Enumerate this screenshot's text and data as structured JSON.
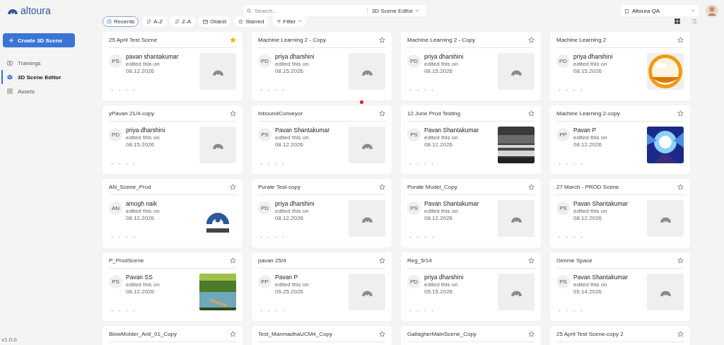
{
  "brand": "altoura",
  "sidebar": {
    "create_button": "Create 3D Scene",
    "items": [
      {
        "label": "Trainings",
        "selected": false
      },
      {
        "label": "3D Scene Editor",
        "selected": true
      },
      {
        "label": "Assets",
        "selected": false
      }
    ],
    "version": "v1.0.0"
  },
  "search": {
    "placeholder": "Search...",
    "scope": "3D Scene Editor"
  },
  "workspace": "Altoura QA",
  "sort_chips": [
    {
      "label": "Recents",
      "selected": true
    },
    {
      "label": "A-Z",
      "selected": false
    },
    {
      "label": "Z-A",
      "selected": false
    },
    {
      "label": "Oldest",
      "selected": false
    },
    {
      "label": "Starred",
      "selected": false
    },
    {
      "label": "Filter",
      "selected": false
    }
  ],
  "view_toggle": [
    {
      "kind": "grid",
      "selected": true
    },
    {
      "kind": "list",
      "selected": false
    }
  ],
  "cards": [
    {
      "title": "25 April Test Scene",
      "starred": true,
      "initials": "PS",
      "name": "pavan shantakumar",
      "edited": "edited this on",
      "date": "08.12.2026",
      "kind": "placeholder"
    },
    {
      "title": "Machine Learning 2 - Copy",
      "starred": false,
      "initials": "PD",
      "name": "priya dharshini",
      "edited": "edited this on",
      "date": "08.15.2026",
      "kind": "placeholder"
    },
    {
      "title": "Machine Learning 2 - Copy",
      "starred": false,
      "initials": "PD",
      "name": "priya dharshini",
      "edited": "edited this on",
      "date": "08.15.2026",
      "kind": "placeholder"
    },
    {
      "title": "Machine Learning 2",
      "starred": false,
      "initials": "PD",
      "name": "priya dharshini",
      "edited": "edited this on",
      "date": "08.15.2026",
      "kind": "picture"
    },
    {
      "title": "yPavan 21/4-copy",
      "starred": false,
      "initials": "PD",
      "name": "priya dharshini",
      "edited": "edited this on",
      "date": "08.15.2026",
      "kind": "placeholder"
    },
    {
      "title": "InboundConveyor",
      "starred": false,
      "initials": "PS",
      "name": "Pavan Shantakumar",
      "edited": "edited this on",
      "date": "08.12.2026",
      "kind": "placeholder"
    },
    {
      "title": "12 June Prod Testing",
      "starred": false,
      "initials": "PS",
      "name": "Pavan Shantakumar",
      "edited": "edited this on",
      "date": "08.12.2026",
      "kind": "picture"
    },
    {
      "title": "Machine Learning 2-copy",
      "starred": false,
      "initials": "PP",
      "name": "Pavan P",
      "edited": "edited this on",
      "date": "08.12.2026",
      "kind": "picture"
    },
    {
      "title": "AN_Scene_Prod",
      "starred": false,
      "initials": "AN",
      "name": "amogh naik",
      "edited": "edited this on",
      "date": "08.12.2026",
      "kind": "picture"
    },
    {
      "title": "Purate Test-copy",
      "starred": false,
      "initials": "PD",
      "name": "priya dharshini",
      "edited": "edited this on",
      "date": "08.12.2026",
      "kind": "placeholder"
    },
    {
      "title": "Purate Model_Copy",
      "starred": false,
      "initials": "PS",
      "name": "Pavan Shantakumar",
      "edited": "edited this on",
      "date": "08.12.2026",
      "kind": "placeholder"
    },
    {
      "title": "27 March - PROD Scene",
      "starred": false,
      "initials": "PS",
      "name": "Pavan Shantakumar",
      "edited": "edited this on",
      "date": "08.12.2026",
      "kind": "placeholder"
    },
    {
      "title": "P_ProdScene",
      "starred": false,
      "initials": "PS",
      "name": "Pavan SS",
      "edited": "edited this on",
      "date": "08.12.2026",
      "kind": "picture"
    },
    {
      "title": "pavan 25/4",
      "starred": false,
      "initials": "PP",
      "name": "Pavan P",
      "edited": "edited this on",
      "date": "05.25.2026",
      "kind": "placeholder"
    },
    {
      "title": "Reg_5/14",
      "starred": false,
      "initials": "PD",
      "name": "priya dharshini",
      "edited": "edited this on",
      "date": "05.15.2026",
      "kind": "placeholder"
    },
    {
      "title": "Gimme Space",
      "starred": false,
      "initials": "PS",
      "name": "Pavan Shantakumar",
      "edited": "edited this on",
      "date": "05.14.2026",
      "kind": "placeholder"
    },
    {
      "title": "BlowMolder_Anil_01_Copy",
      "starred": false
    },
    {
      "title": "Test_ManmadhaUCM4_Copy",
      "starred": false
    },
    {
      "title": "GallagherMainScene_Copy",
      "starred": false
    },
    {
      "title": "25 April Test Scene-copy 2",
      "starred": false
    }
  ]
}
